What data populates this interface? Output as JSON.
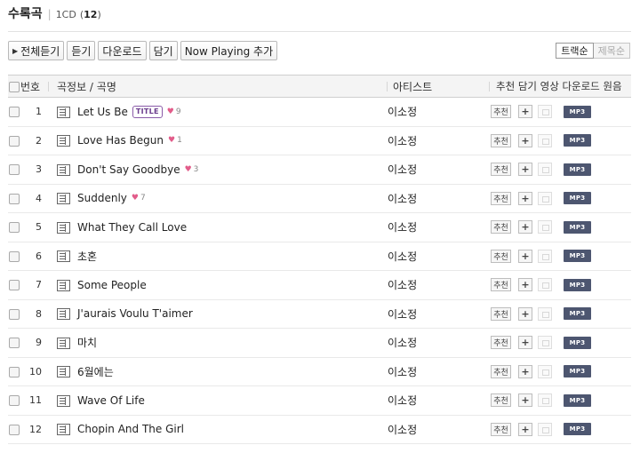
{
  "header": {
    "title": "수록곡",
    "separator": "|",
    "cd": "1CD",
    "count_open": "(",
    "count": "12",
    "count_close": ")"
  },
  "toolbar": {
    "play_all": "전체듣기",
    "listen": "듣기",
    "download": "다운로드",
    "add": "담기",
    "now_playing": "Now Playing 추가"
  },
  "sort": {
    "track": "트랙순",
    "title": "제목순",
    "selected": "트랙순"
  },
  "columns": {
    "number": "번호",
    "song": "곡정보 / 곡명",
    "artist": "아티스트",
    "actions": "추천 담기 영상 다운로드 원음"
  },
  "row_buttons": {
    "recommend": "추천",
    "add": "+",
    "mp3": "MP3"
  },
  "tracks": [
    {
      "no": "1",
      "title": "Let Us Be",
      "badge": "TITLE",
      "likes": "9",
      "artist": "이소정"
    },
    {
      "no": "2",
      "title": "Love Has Begun",
      "badge": "",
      "likes": "1",
      "artist": "이소정"
    },
    {
      "no": "3",
      "title": "Don't Say Goodbye",
      "badge": "",
      "likes": "3",
      "artist": "이소정"
    },
    {
      "no": "4",
      "title": "Suddenly",
      "badge": "",
      "likes": "7",
      "artist": "이소정"
    },
    {
      "no": "5",
      "title": "What They Call Love",
      "badge": "",
      "likes": "",
      "artist": "이소정"
    },
    {
      "no": "6",
      "title": "초혼",
      "badge": "",
      "likes": "",
      "artist": "이소정"
    },
    {
      "no": "7",
      "title": "Some People",
      "badge": "",
      "likes": "",
      "artist": "이소정"
    },
    {
      "no": "8",
      "title": "J'aurais Voulu T'aimer",
      "badge": "",
      "likes": "",
      "artist": "이소정"
    },
    {
      "no": "9",
      "title": "마치",
      "badge": "",
      "likes": "",
      "artist": "이소정"
    },
    {
      "no": "10",
      "title": "6월에는",
      "badge": "",
      "likes": "",
      "artist": "이소정"
    },
    {
      "no": "11",
      "title": "Wave Of Life",
      "badge": "",
      "likes": "",
      "artist": "이소정"
    },
    {
      "no": "12",
      "title": "Chopin And The Girl",
      "badge": "",
      "likes": "",
      "artist": "이소정"
    }
  ],
  "colors": {
    "mp3_bg": "#4d5670",
    "heart": "#e25c8a",
    "title_badge": "#6a3c8c"
  },
  "icons": {
    "lyrics": "lyrics-doc-icon",
    "heart": "heart-icon",
    "video": "video-icon",
    "play": "play-triangle-icon"
  }
}
